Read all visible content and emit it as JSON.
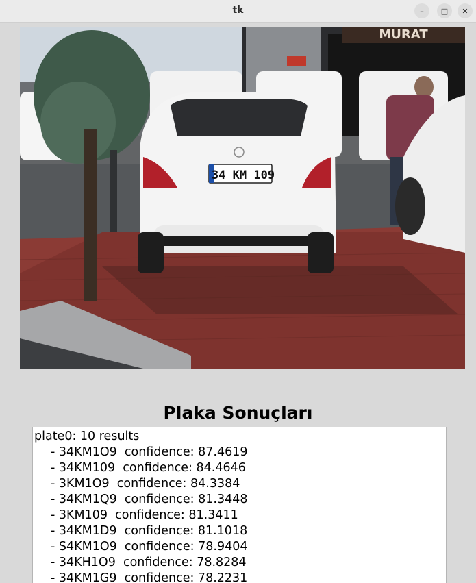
{
  "window": {
    "title": "tk",
    "controls": {
      "minimize": "–",
      "maximize": "□",
      "close": "✕"
    }
  },
  "photo": {
    "plate_text": "34 KM 109",
    "shop_sign": "MURAT",
    "description_icon": "car-photo"
  },
  "heading": "Plaka Sonuçları",
  "results": {
    "header": "plate0: 10 results",
    "items": [
      "- 34KM1O9  confidence: 87.4619",
      "- 34KM109  confidence: 84.4646",
      "- 3KM1O9  confidence: 84.3384",
      "- 34KM1Q9  confidence: 81.3448",
      "- 3KM109  confidence: 81.3411",
      "- 34KM1D9  confidence: 81.1018",
      "- S4KM1O9  confidence: 78.9404",
      "- 34KH1O9  confidence: 78.8284",
      "- 34KM1G9  confidence: 78.2231"
    ]
  }
}
